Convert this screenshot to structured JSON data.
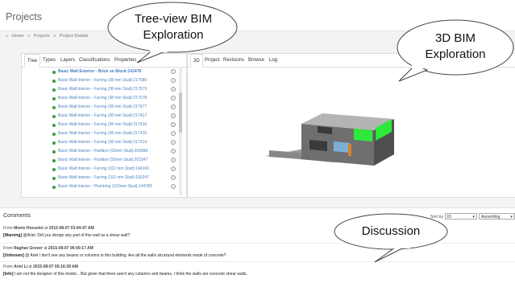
{
  "page": {
    "title": "Projects"
  },
  "breadcrumb": [
    "Home",
    ">",
    "Projects",
    ">",
    "Project Details"
  ],
  "left_tabs": [
    "Tree",
    "Types",
    "Layers",
    "Classifications",
    "Properties"
  ],
  "right_tabs": [
    "3D",
    "Project",
    "Revisions",
    "Browse",
    "Log"
  ],
  "tree_items": [
    "Basic Wall:Exterior - Brick on Block:143478",
    "Basic Wall:Interior - Furring (38 mm Stud):217580",
    "Basic Wall:Interior - Furring (38 mm Stud):217579",
    "Basic Wall:Interior - Furring (38 mm Stud):217578",
    "Basic Wall:Interior - Furring (38 mm Stud):217577",
    "Basic Wall:Interior - Furring (38 mm Stud):217417",
    "Basic Wall:Interior - Furring (38 mm Stud):217416",
    "Basic Wall:Interior - Furring (38 mm Stud):217415",
    "Basic Wall:Interior - Furring (38 mm Stud):217414",
    "Basic Wall:Interior - Partition (92mm Stud):203998",
    "Basic Wall:Interior - Partition (92mm Stud):203347",
    "Basic Wall:Interior - Furring (152 mm Stud):194166",
    "Basic Wall:Interior - Furring (152 mm Stud):193247",
    "Basic Wall:Interior - Plumbing (152mm Stud):144783"
  ],
  "comments_section": {
    "title": "Comments",
    "sort_label": "Sort by",
    "sort_field": "ID",
    "sort_order": "Ascending"
  },
  "comments": [
    {
      "prefix": "From",
      "author": "Moein Hosseini",
      "at": "at",
      "time": "2015-08-07 03:04:47 AM",
      "tag": "[Warning]",
      "text": "@Ariel: Did you design any part of this wall as a shear wall?"
    },
    {
      "prefix": "From",
      "author": "Raghav Grover",
      "at": "at",
      "time": "2015-08-07 06:00:17 AM",
      "tag": "[Unknown]",
      "text": "@ Ariel I don't see any beams or columns in this building. Are all the walls structural elements made of concrete?"
    },
    {
      "prefix": "From",
      "author": "Ariel Li",
      "at": "at",
      "time": "2015-08-07 06:16:39 AM",
      "tag": "[Info]",
      "text": "I am not the designer of this model... But given that there aren't any columns and beams, I think the walls are concrete shear walls."
    }
  ],
  "callouts": {
    "tree_view": [
      "Tree-view BIM",
      "Exploration"
    ],
    "bim_3d": [
      "3D BIM",
      "Exploration"
    ],
    "discussion": [
      "Discussion"
    ]
  },
  "colors": {
    "link": "#4a84c0",
    "bullet": "#3a9a3a",
    "building_green": "#2ee83a",
    "building_orange": "#d9822b"
  }
}
